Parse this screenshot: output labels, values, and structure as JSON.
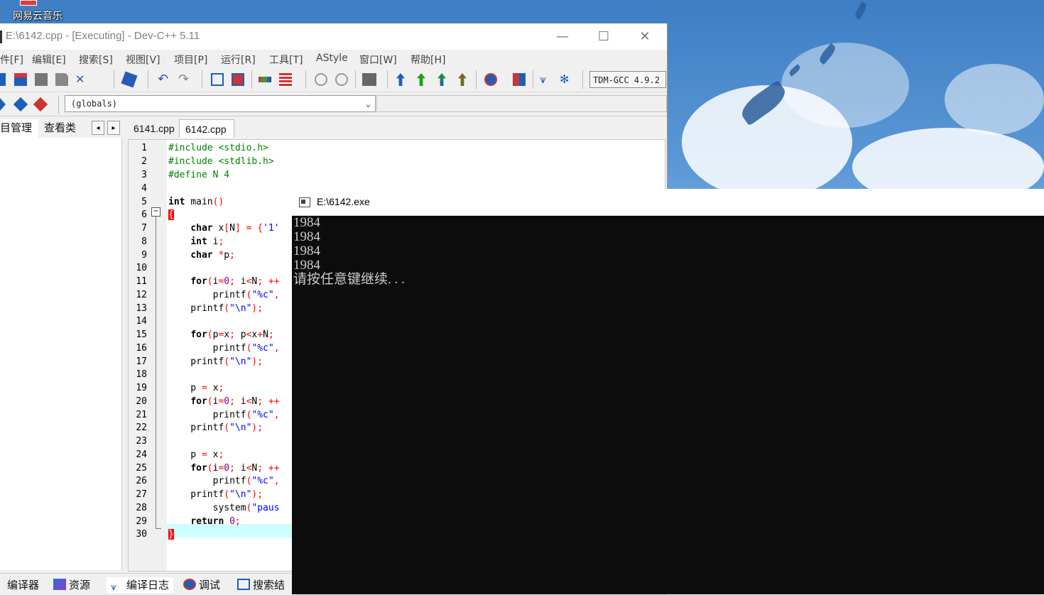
{
  "desktop": {
    "icon_label": "网易云音乐"
  },
  "ide": {
    "title": "E:\\6142.cpp - [Executing] - Dev-C++ 5.11",
    "window_buttons": {
      "minimize": "—",
      "maximize": "☐",
      "close": "✕"
    },
    "menu": [
      "件[F]",
      "编辑[E]",
      "搜索[S]",
      "视图[V]",
      "项目[P]",
      "运行[R]",
      "工具[T]",
      "AStyle",
      "窗口[W]",
      "帮助[H]"
    ],
    "compiler": "TDM-GCC 4.9.2",
    "scope": "(globals)",
    "left_tabs": [
      "目管理",
      "查看类"
    ],
    "file_tabs": [
      "6141.cpp",
      "6142.cpp"
    ],
    "bottom_tabs": [
      "编译器",
      "资源",
      "编译日志",
      "调试",
      "搜索结"
    ],
    "line_numbers": [
      "1",
      "2",
      "3",
      "4",
      "5",
      "6",
      "7",
      "8",
      "9",
      "10",
      "11",
      "12",
      "13",
      "14",
      "15",
      "16",
      "17",
      "18",
      "19",
      "20",
      "21",
      "22",
      "23",
      "24",
      "25",
      "26",
      "27",
      "28",
      "29",
      "30"
    ]
  },
  "console": {
    "title": "E:\\6142.exe",
    "lines": [
      "1984",
      "1984",
      "1984",
      "1984",
      "请按任意键继续. . ."
    ]
  },
  "colors": {
    "console_bg": "#0c0c0c",
    "console_text": "#cccccc",
    "current_line": "#ccffff",
    "brace_highlight": "#ff0000"
  }
}
